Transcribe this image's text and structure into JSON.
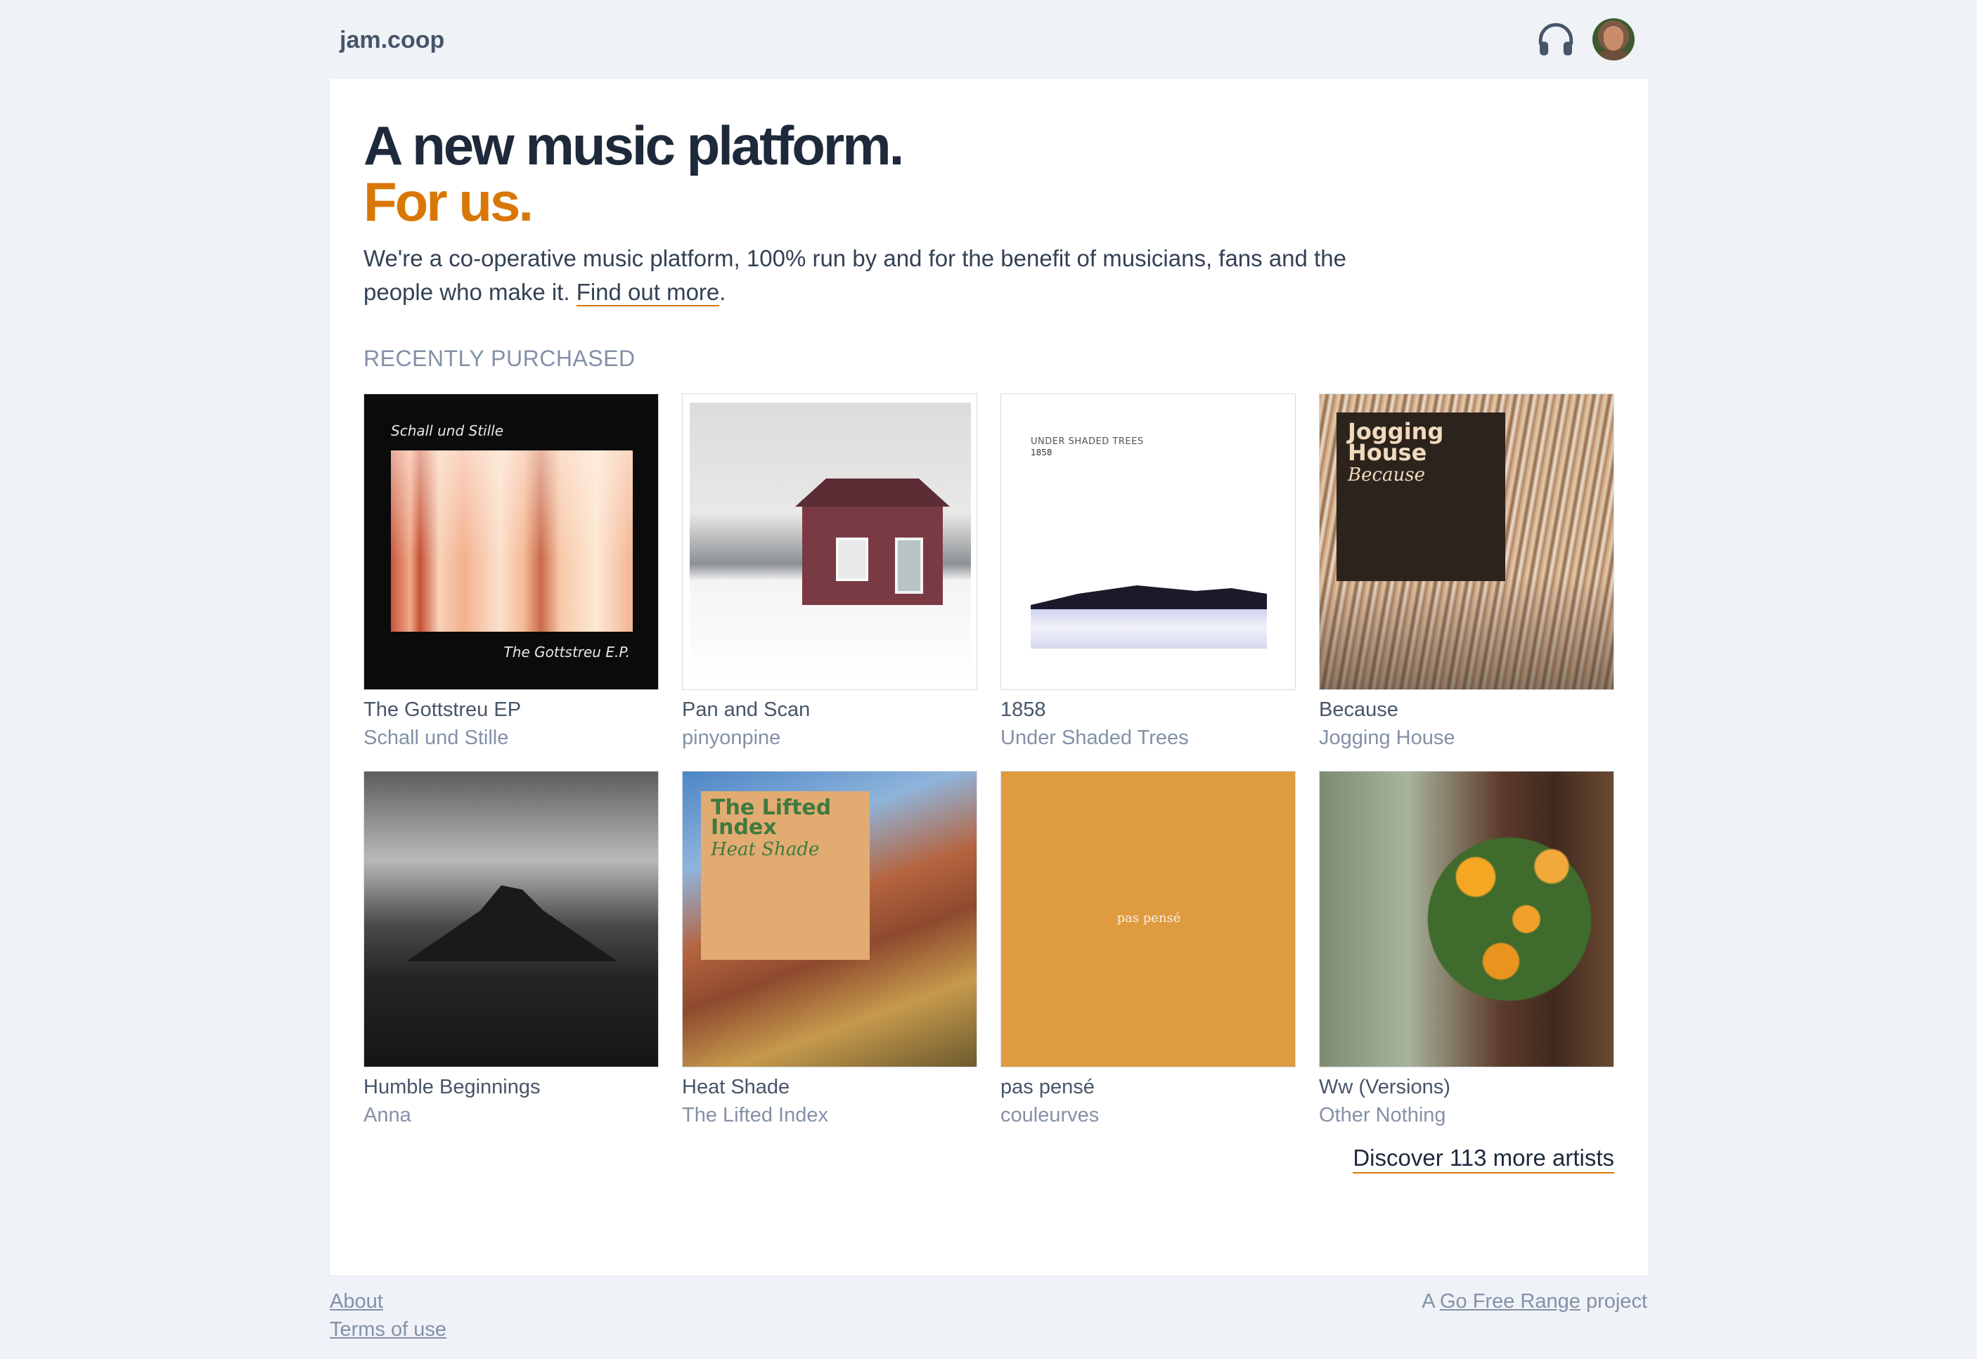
{
  "header": {
    "brand": "jam.coop",
    "icons": [
      "headphones-icon",
      "user-avatar"
    ]
  },
  "hero": {
    "line1": "A new music platform.",
    "line2": "For us.",
    "intro_text": "We're a co-operative music platform, 100% run by and for the benefit of musicians, fans and the people who make it.",
    "intro_link": "Find out more",
    "intro_end": "."
  },
  "recently_purchased": {
    "title": "RECENTLY PURCHASED",
    "albums": [
      {
        "title": "The Gottstreu EP",
        "artist": "Schall und Stille",
        "cover_text_top": "Schall und Stille",
        "cover_text_bottom": "The Gottstreu E.P."
      },
      {
        "title": "Pan and Scan",
        "artist": "pinyonpine"
      },
      {
        "title": "1858",
        "artist": "Under Shaded Trees",
        "cover_text_top": "UNDER SHADED TREES",
        "cover_text_bottom": "1858"
      },
      {
        "title": "Because",
        "artist": "Jogging House",
        "cover_text_top": "Jogging House",
        "cover_text_bottom": "Because"
      },
      {
        "title": "Humble Beginnings",
        "artist": "Anna"
      },
      {
        "title": "Heat Shade",
        "artist": "The Lifted Index",
        "cover_text_top": "The Lifted Index",
        "cover_text_bottom": "Heat Shade"
      },
      {
        "title": "pas pensé",
        "artist": "couleurves",
        "cover_text_top": "pas pensé"
      },
      {
        "title": "Ww (Versions)",
        "artist": "Other Nothing"
      }
    ]
  },
  "discover_link": "Discover 113 more artists",
  "footer": {
    "about": "About",
    "terms": "Terms of use",
    "credit_prefix": "A",
    "credit_link": "Go Free Range",
    "credit_suffix": "project"
  },
  "colors": {
    "accent": "#d97706",
    "heading": "#1e293b",
    "muted": "#8391a7",
    "background": "#eff2f7"
  }
}
